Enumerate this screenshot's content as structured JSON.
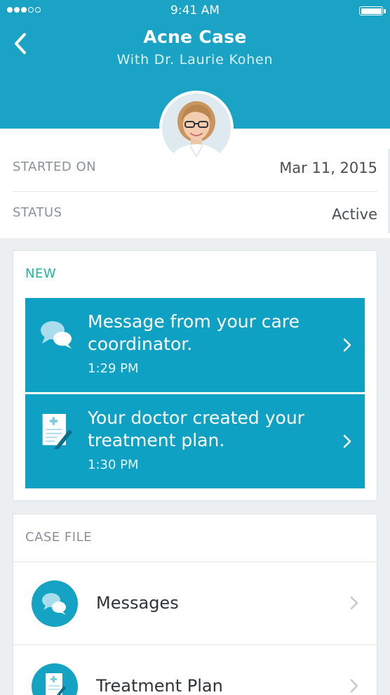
{
  "status_bar": {
    "time": "9:41 AM",
    "signal_icon": "signal-dots-icon",
    "battery_icon": "battery-icon"
  },
  "header": {
    "back_icon": "chevron-left-icon",
    "title": "Acne Case",
    "subtitle": "With Dr. Laurie Kohen",
    "avatar": "doctor-avatar"
  },
  "info": {
    "started_label": "STARTED ON",
    "started_value": "Mar 11, 2015",
    "status_label": "STATUS",
    "status_value": "Active"
  },
  "new_section": {
    "label": "NEW",
    "items": [
      {
        "text": "Message from your care coordinator.",
        "time": "1:29 PM",
        "icon": "chat-bubbles-icon"
      },
      {
        "text": "Your doctor created your treatment plan.",
        "time": "1:30 PM",
        "icon": "document-pen-icon"
      }
    ]
  },
  "case_file": {
    "label": "CASE FILE",
    "items": [
      {
        "label": "Messages",
        "icon": "chat-bubbles-icon"
      },
      {
        "label": "Treatment Plan",
        "icon": "document-pen-icon"
      }
    ]
  },
  "colors": {
    "header": "#1aa3c4",
    "notification": "#0fa1c3",
    "accent_green": "#1fb59f"
  }
}
